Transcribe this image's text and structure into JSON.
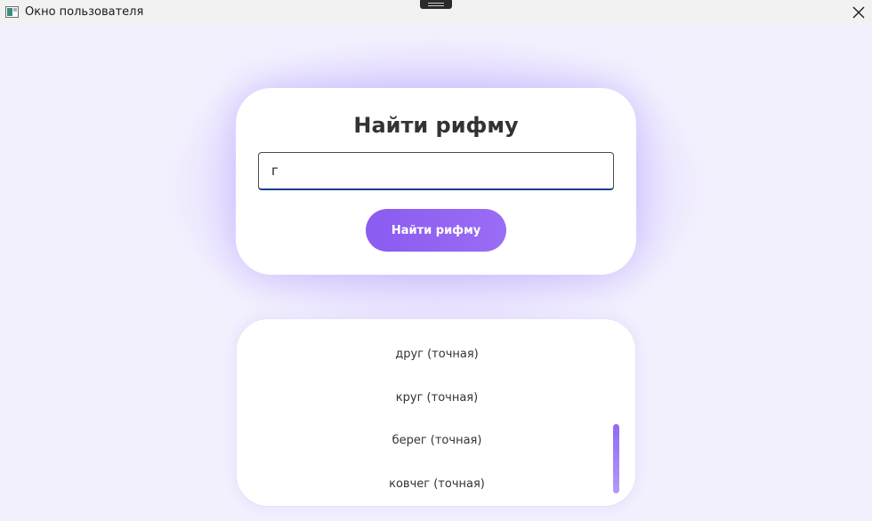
{
  "window": {
    "title": "Окно пользователя",
    "icons": {
      "app": "app-window-icon",
      "close": "close-icon",
      "handle": "drag-handle"
    }
  },
  "search": {
    "title": "Найти рифму",
    "input_value": "г",
    "button_label": "Найти рифму"
  },
  "results": {
    "items": [
      "друг (точная)",
      "круг (точная)",
      "берег (точная)",
      "ковчег (точная)"
    ]
  },
  "colors": {
    "accent": "#8a5cf0",
    "background": "#f3f0fe",
    "card": "#ffffff",
    "text": "#333333"
  }
}
